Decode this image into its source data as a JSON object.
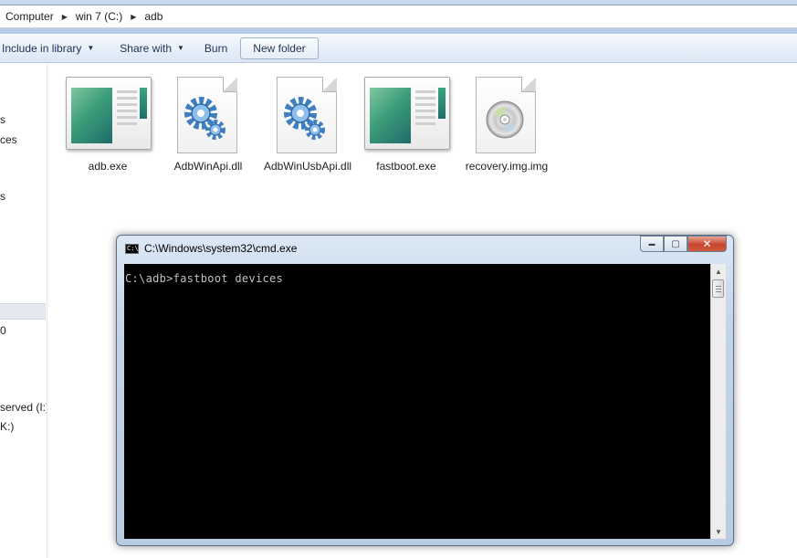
{
  "address_bar": {
    "crumbs": [
      "Computer",
      "win 7 (C:)",
      "adb"
    ]
  },
  "command_bar": {
    "include_in_library": "Include in library",
    "share_with": "Share with",
    "burn": "Burn",
    "new_folder": "New folder"
  },
  "nav_pane": {
    "items": [
      "s",
      "ces",
      "s",
      "0",
      "served (I:)",
      "K:)"
    ]
  },
  "files": [
    {
      "name": "adb.exe",
      "icon": "application-window-icon"
    },
    {
      "name": "AdbWinApi.dll",
      "icon": "gears-document-icon"
    },
    {
      "name": "AdbWinUsbApi.dll",
      "icon": "gears-document-icon"
    },
    {
      "name": "fastboot.exe",
      "icon": "application-window-icon"
    },
    {
      "name": "recovery.img.img",
      "icon": "disc-document-icon"
    }
  ],
  "cmd_window": {
    "title": "C:\\Windows\\system32\\cmd.exe",
    "icon_text": "C:\\",
    "console_line": "C:\\adb>fastboot devices",
    "minimize_glyph": "▬",
    "maximize_glyph": "▢",
    "close_glyph": "✕"
  },
  "colors": {
    "console_background": "#000000",
    "console_text": "#c0c0c0",
    "close_button": "#c5472f",
    "window_frame": "#c3d4e8"
  }
}
